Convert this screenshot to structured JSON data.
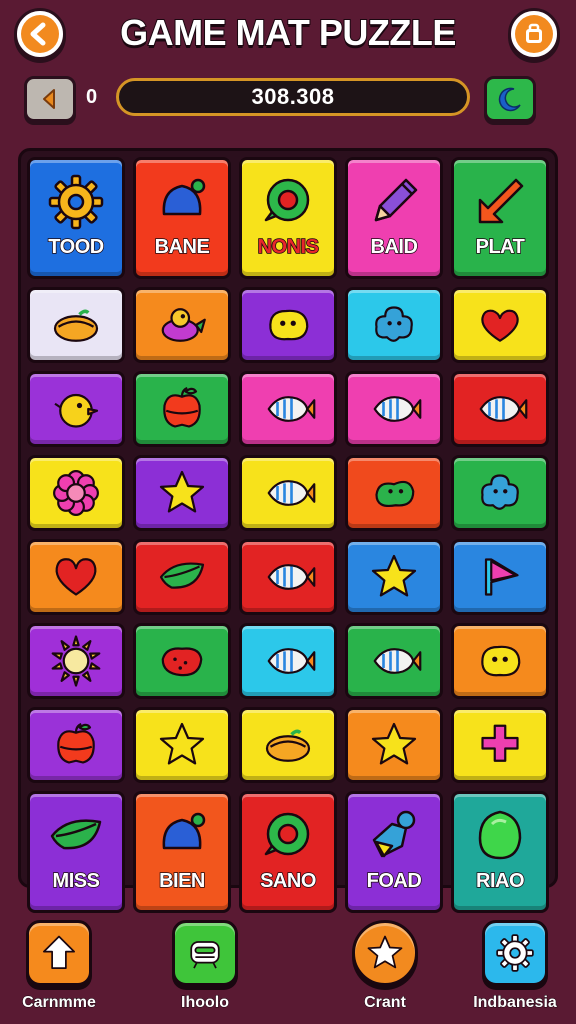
{
  "header": {
    "title": "GAME MAT PUZZLE",
    "back_icon": "arrow-left-icon",
    "right_icon": "shop-bag-icon"
  },
  "status": {
    "prev_icon": "chevron-left-icon",
    "score_prefix": "0",
    "score": "308.308",
    "moon_icon": "moon-icon"
  },
  "board": {
    "rows": [
      [
        {
          "color": "#1e6fe0",
          "icon": "gear-icon",
          "label": "TOOD"
        },
        {
          "color": "#f23a1d",
          "icon": "cap-icon",
          "label": "BANE"
        },
        {
          "color": "#f7e21b",
          "icon": "donut-icon",
          "label": "NONIS",
          "label_color": "#e8262b"
        },
        {
          "color": "#ef3fb0",
          "icon": "pencil-icon",
          "label": "BAID"
        },
        {
          "color": "#29b34b",
          "icon": "arrow-down-left-icon",
          "label": "PLAT"
        }
      ],
      [
        {
          "color": "#e9e5f5",
          "icon": "bread-icon"
        },
        {
          "color": "#f58a1d",
          "icon": "bird-icon"
        },
        {
          "color": "#8c2fd6",
          "icon": "blob-icon"
        },
        {
          "color": "#2cc8ea",
          "icon": "flower-blob-icon"
        },
        {
          "color": "#f7e21b",
          "icon": "heart-blob-icon"
        }
      ],
      [
        {
          "color": "#9a32d8",
          "icon": "chick-icon"
        },
        {
          "color": "#29b34b",
          "icon": "apple-icon"
        },
        {
          "color": "#ef3fb0",
          "icon": "fish-icon"
        },
        {
          "color": "#ef3fb0",
          "icon": "fish-icon"
        },
        {
          "color": "#e22323",
          "icon": "fish-icon"
        }
      ],
      [
        {
          "color": "#f7e21b",
          "icon": "flower-icon"
        },
        {
          "color": "#8c2fd6",
          "icon": "star-icon"
        },
        {
          "color": "#f7e21b",
          "icon": "fish-icon"
        },
        {
          "color": "#f04a1d",
          "icon": "bean-icon"
        },
        {
          "color": "#29b34b",
          "icon": "flower-blob-icon"
        }
      ],
      [
        {
          "color": "#f58a1d",
          "icon": "heart-icon"
        },
        {
          "color": "#e22323",
          "icon": "leaf-icon"
        },
        {
          "color": "#e22323",
          "icon": "fish-icon"
        },
        {
          "color": "#2a86e0",
          "icon": "star-icon"
        },
        {
          "color": "#2a86e0",
          "icon": "flag-icon"
        }
      ],
      [
        {
          "color": "#a02fd8",
          "icon": "sun-icon"
        },
        {
          "color": "#29b34b",
          "icon": "strawberry-icon"
        },
        {
          "color": "#2cc8ea",
          "icon": "fish-icon"
        },
        {
          "color": "#29b34b",
          "icon": "fish-icon"
        },
        {
          "color": "#f58a1d",
          "icon": "blob-icon"
        }
      ],
      [
        {
          "color": "#9a32d8",
          "icon": "apple-icon"
        },
        {
          "color": "#f7e21b",
          "icon": "star-icon"
        },
        {
          "color": "#f7e21b",
          "icon": "bread-icon"
        },
        {
          "color": "#f58a1d",
          "icon": "star-icon"
        },
        {
          "color": "#f7e21b",
          "icon": "plus-icon"
        }
      ],
      [
        {
          "color": "#8c2fd6",
          "icon": "leaf-icon",
          "label": "MISS"
        },
        {
          "color": "#f2561d",
          "icon": "cap-icon",
          "label": "BIEN"
        },
        {
          "color": "#e22323",
          "icon": "donut-icon",
          "label": "SANO"
        },
        {
          "color": "#8c2fd6",
          "icon": "bottle-icon",
          "label": "FOAD"
        },
        {
          "color": "#1fa89a",
          "icon": "egg-icon",
          "label": "RIAO"
        }
      ]
    ]
  },
  "bottom_nav": [
    {
      "label": "Carnmme",
      "icon": "arrow-up-icon",
      "color": "#f58a1d"
    },
    {
      "label": "Ihoolo",
      "icon": "robot-icon",
      "color": "#3fc53a"
    },
    {
      "label": "Crant",
      "icon": "star-icon",
      "color": "#f28a1f"
    },
    {
      "label": "Indbanesia",
      "icon": "gear-icon",
      "color": "#2cb8ec"
    }
  ]
}
